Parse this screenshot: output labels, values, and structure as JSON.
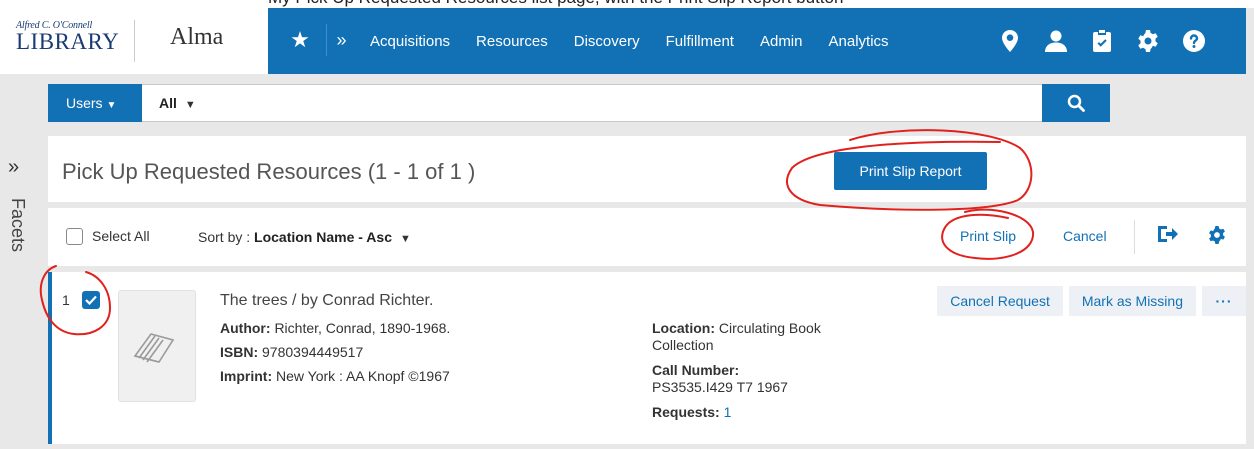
{
  "caption": {
    "text": "My Pick Up Requested Resources list page, with the Print Slip Report button"
  },
  "logo": {
    "small": "Alfred C. O'Connell",
    "big": "LIBRARY"
  },
  "app": {
    "name": "Alma"
  },
  "nav": {
    "items": [
      "Acquisitions",
      "Resources",
      "Discovery",
      "Fulfillment",
      "Admin",
      "Analytics"
    ]
  },
  "icons": [
    "location-icon",
    "user-icon",
    "clipboard-icon",
    "gear-icon",
    "help-icon"
  ],
  "search": {
    "scope": "Users",
    "category": "All"
  },
  "facets": {
    "label": "Facets"
  },
  "page": {
    "title": "Pick Up Requested Resources (1 - 1 of 1 )",
    "print_report": "Print Slip Report"
  },
  "toolbar": {
    "select_all": "Select All",
    "sort_prefix": "Sort by : ",
    "sort_value": "Location Name - Asc",
    "print_slip": "Print Slip",
    "cancel": "Cancel"
  },
  "result": {
    "number": "1",
    "title": "The trees / by Conrad Richter.",
    "author_label": "Author:",
    "author": "Richter, Conrad, 1890-1968.",
    "isbn_label": "ISBN:",
    "isbn": "9780394449517",
    "imprint_label": "Imprint:",
    "imprint": "New York : AA Knopf ©1967",
    "location_label": "Location:",
    "location": "Circulating Book Collection",
    "call_label": "Call Number:",
    "call_number": "PS3535.I429 T7 1967",
    "requests_label": "Requests:",
    "requests": "1",
    "actions": {
      "cancel_request": "Cancel Request",
      "mark_missing": "Mark as Missing",
      "more": "···"
    }
  },
  "colors": {
    "primary": "#1271b5",
    "annotation": "#e0221e"
  }
}
